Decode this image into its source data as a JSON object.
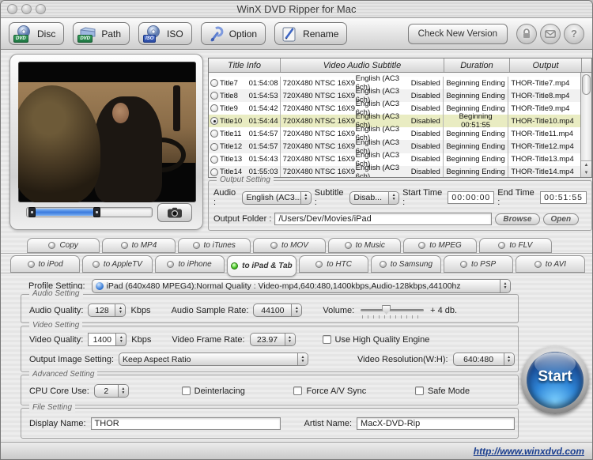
{
  "window": {
    "title": "WinX DVD Ripper for Mac"
  },
  "colors": {
    "selected_row": "#e9ecc2",
    "tab_led_active": "#3dbb1e",
    "start_button_blue": "#2f86d8",
    "link_blue": "#1b3f8f",
    "trim_fill_blue": "#3a7ade"
  },
  "toolbar": {
    "buttons": [
      {
        "label": "Disc",
        "badge": "DVD"
      },
      {
        "label": "Path",
        "badge": "DVD"
      },
      {
        "label": "ISO",
        "badge": "ISO"
      },
      {
        "label": "Option"
      },
      {
        "label": "Rename"
      }
    ],
    "check_new_version_label": "Check New Version",
    "help_glyph": "?"
  },
  "preview": {
    "trim": {
      "fill_start_percent": 4,
      "fill_width_percent": 52
    }
  },
  "title_table": {
    "headers": [
      "Title Info",
      "Video Audio Subtitle",
      "Duration",
      "Output"
    ],
    "rows": [
      {
        "name": "Title7",
        "time": "01:54:08",
        "video": "720X480 NTSC 16X9",
        "audio": "English (AC3 6ch)",
        "subtitle": "Disabled",
        "duration": "Beginning Ending",
        "output": "THOR-Title7.mp4",
        "selected": false
      },
      {
        "name": "Title8",
        "time": "01:54:53",
        "video": "720X480 NTSC 16X9",
        "audio": "English (AC3 6ch)",
        "subtitle": "Disabled",
        "duration": "Beginning Ending",
        "output": "THOR-Title8.mp4",
        "selected": false
      },
      {
        "name": "Title9",
        "time": "01:54:42",
        "video": "720X480 NTSC 16X9",
        "audio": "English (AC3 6ch)",
        "subtitle": "Disabled",
        "duration": "Beginning Ending",
        "output": "THOR-Title9.mp4",
        "selected": false
      },
      {
        "name": "Title10",
        "time": "01:54:44",
        "video": "720X480 NTSC 16X9",
        "audio": "English (AC3 6ch)",
        "subtitle": "Disabled",
        "duration": "Beginning 00:51:55",
        "output": "THOR-Title10.mp4",
        "selected": true
      },
      {
        "name": "Title11",
        "time": "01:54:57",
        "video": "720X480 NTSC 16X9",
        "audio": "English (AC3 6ch)",
        "subtitle": "Disabled",
        "duration": "Beginning Ending",
        "output": "THOR-Title11.mp4",
        "selected": false
      },
      {
        "name": "Title12",
        "time": "01:54:57",
        "video": "720X480 NTSC 16X9",
        "audio": "English (AC3 6ch)",
        "subtitle": "Disabled",
        "duration": "Beginning Ending",
        "output": "THOR-Title12.mp4",
        "selected": false
      },
      {
        "name": "Title13",
        "time": "01:54:43",
        "video": "720X480 NTSC 16X9",
        "audio": "English (AC3 6ch)",
        "subtitle": "Disabled",
        "duration": "Beginning Ending",
        "output": "THOR-Title13.mp4",
        "selected": false
      },
      {
        "name": "Title14",
        "time": "01:55:03",
        "video": "720X480 NTSC 16X9",
        "audio": "English (AC3 6ch)",
        "subtitle": "Disabled",
        "duration": "Beginning Ending",
        "output": "THOR-Title14.mp4",
        "selected": false
      }
    ]
  },
  "output_setting": {
    "title": "Output Setting",
    "audio_label": "Audio :",
    "audio_value": "English (AC3...",
    "subtitle_label": "Subtitle :",
    "subtitle_value": "Disab...",
    "start_time_label": "Start Time :",
    "start_time": "00:00:00",
    "end_time_label": "End Time :",
    "end_time": "00:51:55",
    "output_folder_label": "Output Folder :",
    "output_folder": "/Users/Dev/Movies/iPad",
    "browse_label": "Browse",
    "open_label": "Open"
  },
  "format_tabs": {
    "row1": [
      {
        "label": "Copy"
      },
      {
        "label": "to MP4"
      },
      {
        "label": "to iTunes"
      },
      {
        "label": "to MOV"
      },
      {
        "label": "to Music"
      },
      {
        "label": "to MPEG"
      },
      {
        "label": "to FLV"
      }
    ],
    "row2": [
      {
        "label": "to iPod"
      },
      {
        "label": "to AppleTV"
      },
      {
        "label": "to iPhone"
      },
      {
        "label": "to iPad & Tab",
        "selected": true
      },
      {
        "label": "to HTC"
      },
      {
        "label": "to Samsung"
      },
      {
        "label": "to PSP"
      },
      {
        "label": "to AVI"
      }
    ]
  },
  "profile_setting": {
    "label": "Profile Setting:",
    "value": "iPad (640x480 MPEG4):Normal Quality : Video-mp4,640:480,1400kbps,Audio-128kbps,44100hz"
  },
  "audio_setting": {
    "title": "Audio Setting",
    "quality_label": "Audio Quality:",
    "quality_value": "128",
    "quality_unit": "Kbps",
    "sample_rate_label": "Audio Sample Rate:",
    "sample_rate_value": "44100",
    "volume_label": "Volume:",
    "volume_text": "+ 4 db.",
    "volume_percent": 40
  },
  "video_setting": {
    "title": "Video Setting",
    "quality_label": "Video Quality:",
    "quality_value": "1400",
    "quality_unit": "Kbps",
    "frame_rate_label": "Video Frame Rate:",
    "frame_rate_value": "23.97",
    "hq_engine_label": "Use High Quality Engine",
    "hq_engine_checked": false,
    "image_setting_label": "Output Image Setting:",
    "image_setting_value": "Keep Aspect Ratio",
    "resolution_label": "Video Resolution(W:H):",
    "resolution_value": "640:480"
  },
  "advanced_setting": {
    "title": "Advanced Setting",
    "cpu_label": "CPU Core Use:",
    "cpu_value": "2",
    "checkboxes": [
      {
        "label": "Deinterlacing",
        "checked": false
      },
      {
        "label": "Force A/V Sync",
        "checked": false
      },
      {
        "label": "Safe Mode",
        "checked": false
      }
    ]
  },
  "file_setting": {
    "title": "File Setting",
    "display_name_label": "Display Name:",
    "display_name": "THOR",
    "artist_name_label": "Artist Name:",
    "artist_name": "MacX-DVD-Rip"
  },
  "start_button_label": "Start",
  "footer": {
    "link": "http://www.winxdvd.com"
  }
}
